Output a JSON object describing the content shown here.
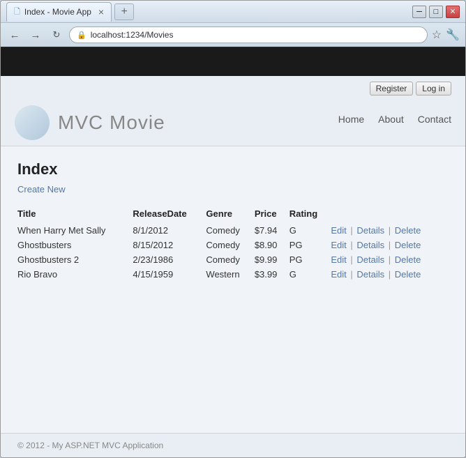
{
  "browser": {
    "tab_title": "Index - Movie App",
    "tab_close": "×",
    "tab_new": "+",
    "url": "localhost:1234/Movies",
    "win_minimize": "─",
    "win_restore": "□",
    "win_close": "✕"
  },
  "navbar": {},
  "app_header": {
    "title": "MVC Movie",
    "register_label": "Register",
    "login_label": "Log in",
    "nav_links": [
      "Home",
      "About",
      "Contact"
    ]
  },
  "main": {
    "page_title": "Index",
    "create_new_label": "Create New",
    "table_headers": [
      "Title",
      "ReleaseDate",
      "Genre",
      "Price",
      "Rating"
    ],
    "movies": [
      {
        "title": "When Harry Met Sally",
        "release_date": "8/1/2012",
        "genre": "Comedy",
        "price": "$7.94",
        "rating": "G"
      },
      {
        "title": "Ghostbusters",
        "release_date": "8/15/2012",
        "genre": "Comedy",
        "price": "$8.90",
        "rating": "PG"
      },
      {
        "title": "Ghostbusters 2",
        "release_date": "2/23/1986",
        "genre": "Comedy",
        "price": "$9.99",
        "rating": "PG"
      },
      {
        "title": "Rio Bravo",
        "release_date": "4/15/1959",
        "genre": "Western",
        "price": "$3.99",
        "rating": "G"
      }
    ],
    "actions": [
      "Edit",
      "Details",
      "Delete"
    ]
  },
  "footer": {
    "text": "© 2012 - My ASP.NET MVC Application"
  }
}
